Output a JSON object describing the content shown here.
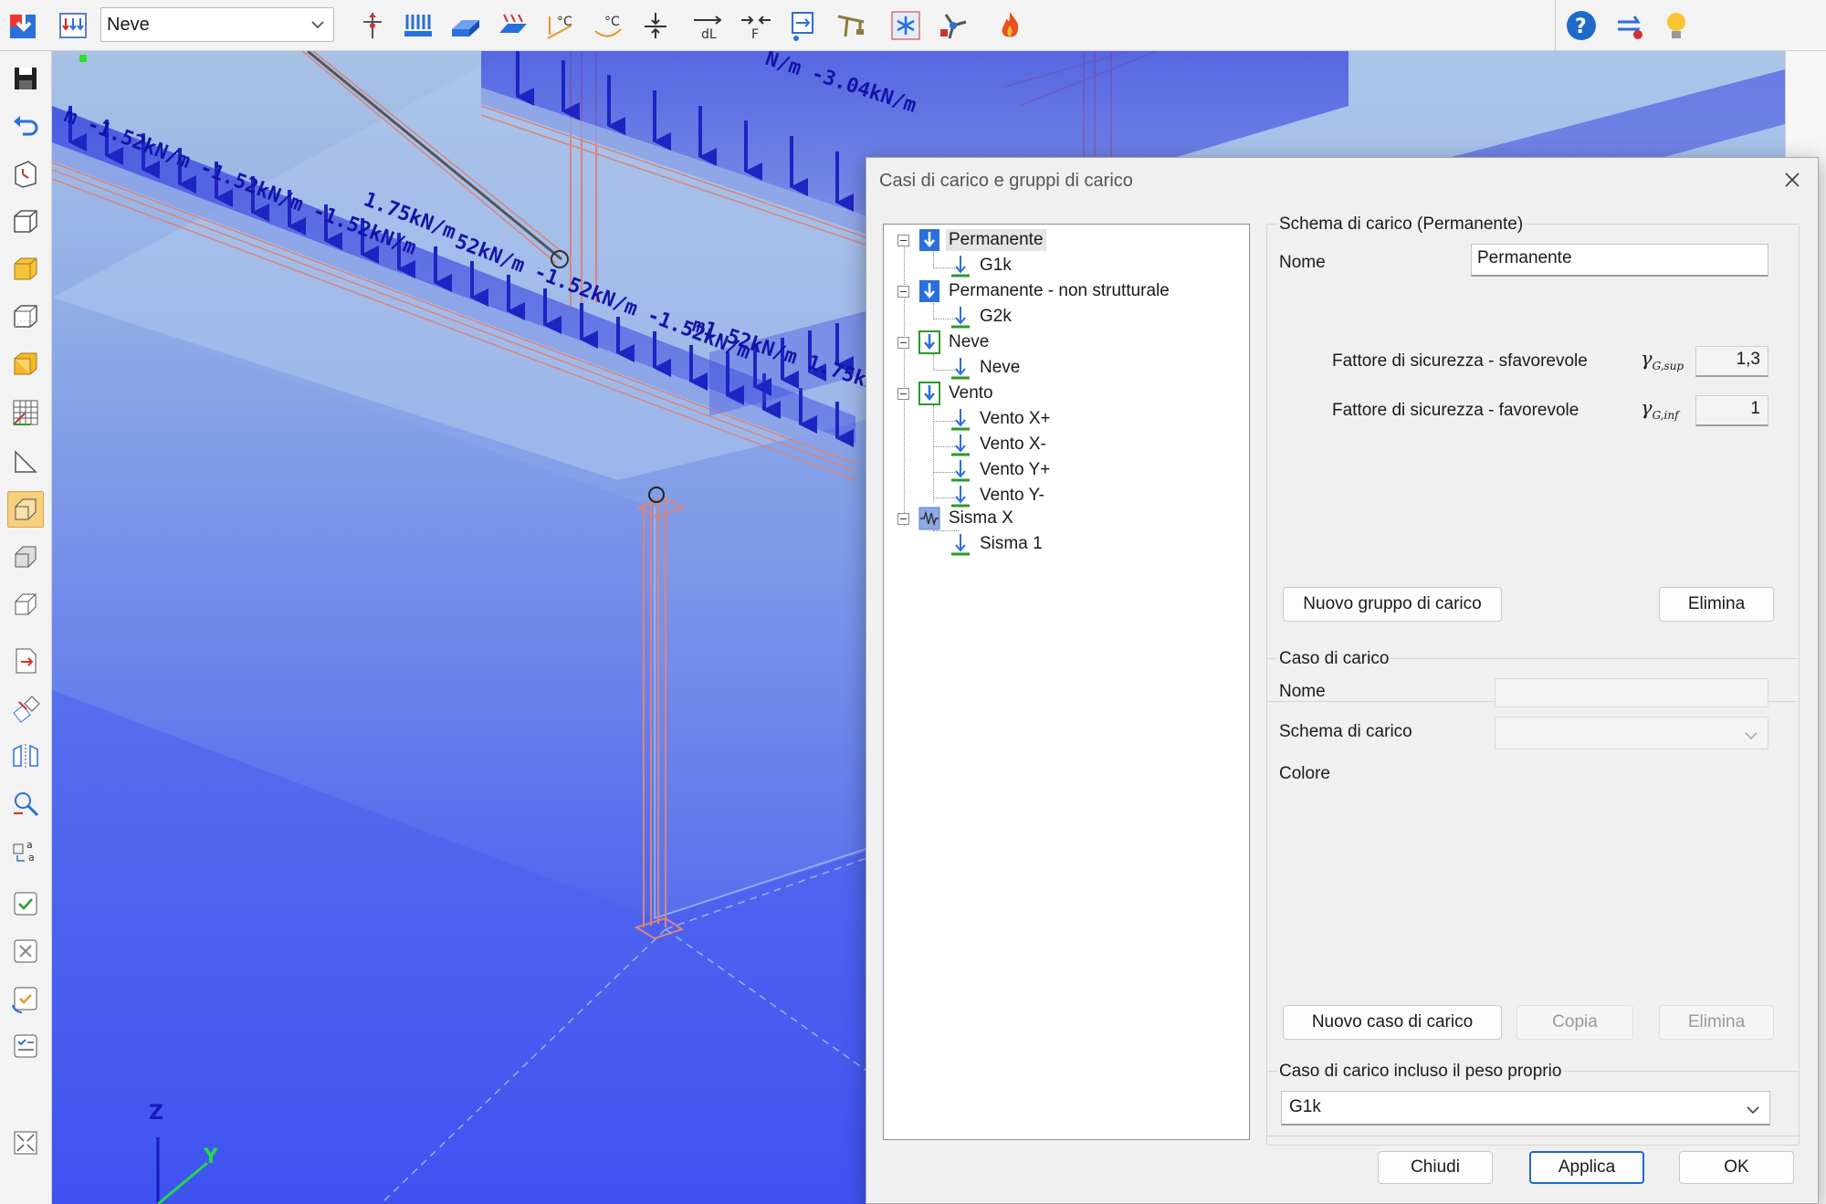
{
  "toolbar": {
    "combo_value": "Neve",
    "icons": [
      "app-logo-icon",
      "load-groups-icon",
      "move-icon",
      "distributed-load-icon",
      "area-load-icon",
      "surface-load-icon",
      "temperature-load-icon",
      "temperature-gradient-icon",
      "support-settlement-icon",
      "length-change-icon",
      "prestress-force-icon",
      "imposed-displacement-icon",
      "crane-load-icon",
      "snow-load-icon",
      "wind-load-icon",
      "fire-icon",
      "help-icon",
      "update-icon",
      "tip-icon"
    ]
  },
  "leftbar": {
    "icons": [
      "save-icon",
      "undo-icon",
      "coordinate-system-icon",
      "wireframe-view-icon",
      "solid-view-icon",
      "hidden-line-view-icon",
      "rendered-view-icon",
      "grid-icon",
      "plane-icon",
      "section-view-icon",
      "box-icon",
      "box-outline-icon",
      "export-icon",
      "transform-icon",
      "mirror-icon",
      "zoom-icon",
      "rename-icon",
      "check-icon",
      "check-cross-icon",
      "check-cycle-icon",
      "checklist-icon",
      "fit-view-icon"
    ]
  },
  "viewport": {
    "load_labels": {
      "top_beam": "N/m -3.04kN/m",
      "left_beam": "m -1.52kN/m -1.52kN/m -1.52kN/m",
      "mid_beam": "1.75kN/m",
      "mid_beam2": "52kN/m -1.52kN/m -1.52kN/m",
      "right_beam": "m1.52kN/m 1.75kN"
    },
    "axes": {
      "z": "Z",
      "y": "Y"
    }
  },
  "dialog": {
    "title": "Casi di carico e gruppi di carico",
    "tree": [
      {
        "label": "Permanente",
        "level": 0,
        "icon": "blue",
        "selected": true
      },
      {
        "label": "G1k",
        "level": 1
      },
      {
        "label": "Permanente - non strutturale",
        "level": 0,
        "icon": "blue"
      },
      {
        "label": "G2k",
        "level": 1
      },
      {
        "label": "Neve",
        "level": 0,
        "icon": "green"
      },
      {
        "label": "Neve",
        "level": 1
      },
      {
        "label": "Vento",
        "level": 0,
        "icon": "green"
      },
      {
        "label": "Vento X+",
        "level": 1
      },
      {
        "label": "Vento X-",
        "level": 1
      },
      {
        "label": "Vento Y+",
        "level": 1
      },
      {
        "label": "Vento Y-",
        "level": 1
      },
      {
        "label": "Sisma X",
        "level": 0,
        "icon": "seismic"
      },
      {
        "label": "Sisma 1",
        "level": 1
      }
    ],
    "schema_group": {
      "title": "Schema di carico (Permanente)",
      "nome_label": "Nome",
      "nome_value": "Permanente",
      "sfav_label": "Fattore di sicurezza - sfavorevole",
      "sfav_symbol": "γ",
      "sfav_sub": "G,sup",
      "sfav_value": "1,3",
      "fav_label": "Fattore di sicurezza - favorevole",
      "fav_symbol": "γ",
      "fav_sub": "G,inf",
      "fav_value": "1",
      "new_group_button": "Nuovo gruppo di carico",
      "delete_button": "Elimina"
    },
    "case_group": {
      "title": "Caso di carico",
      "nome_label": "Nome",
      "nome_value": "",
      "schema_label": "Schema di carico",
      "schema_value": "",
      "colore_label": "Colore",
      "new_case_button": "Nuovo caso di carico",
      "copy_button": "Copia",
      "delete_button": "Elimina"
    },
    "selfweight_group": {
      "title": "Caso di carico incluso il peso proprio",
      "value": "G1k"
    },
    "buttons": {
      "close": "Chiudi",
      "apply": "Applica",
      "ok": "OK"
    }
  },
  "colors": {
    "accent": "#1e6ac9",
    "viewport_top": "#a9c4e8",
    "viewport_bottom": "#3d55f0",
    "load_arrow": "#2b2fc8",
    "member_outline": "#d9857a"
  }
}
